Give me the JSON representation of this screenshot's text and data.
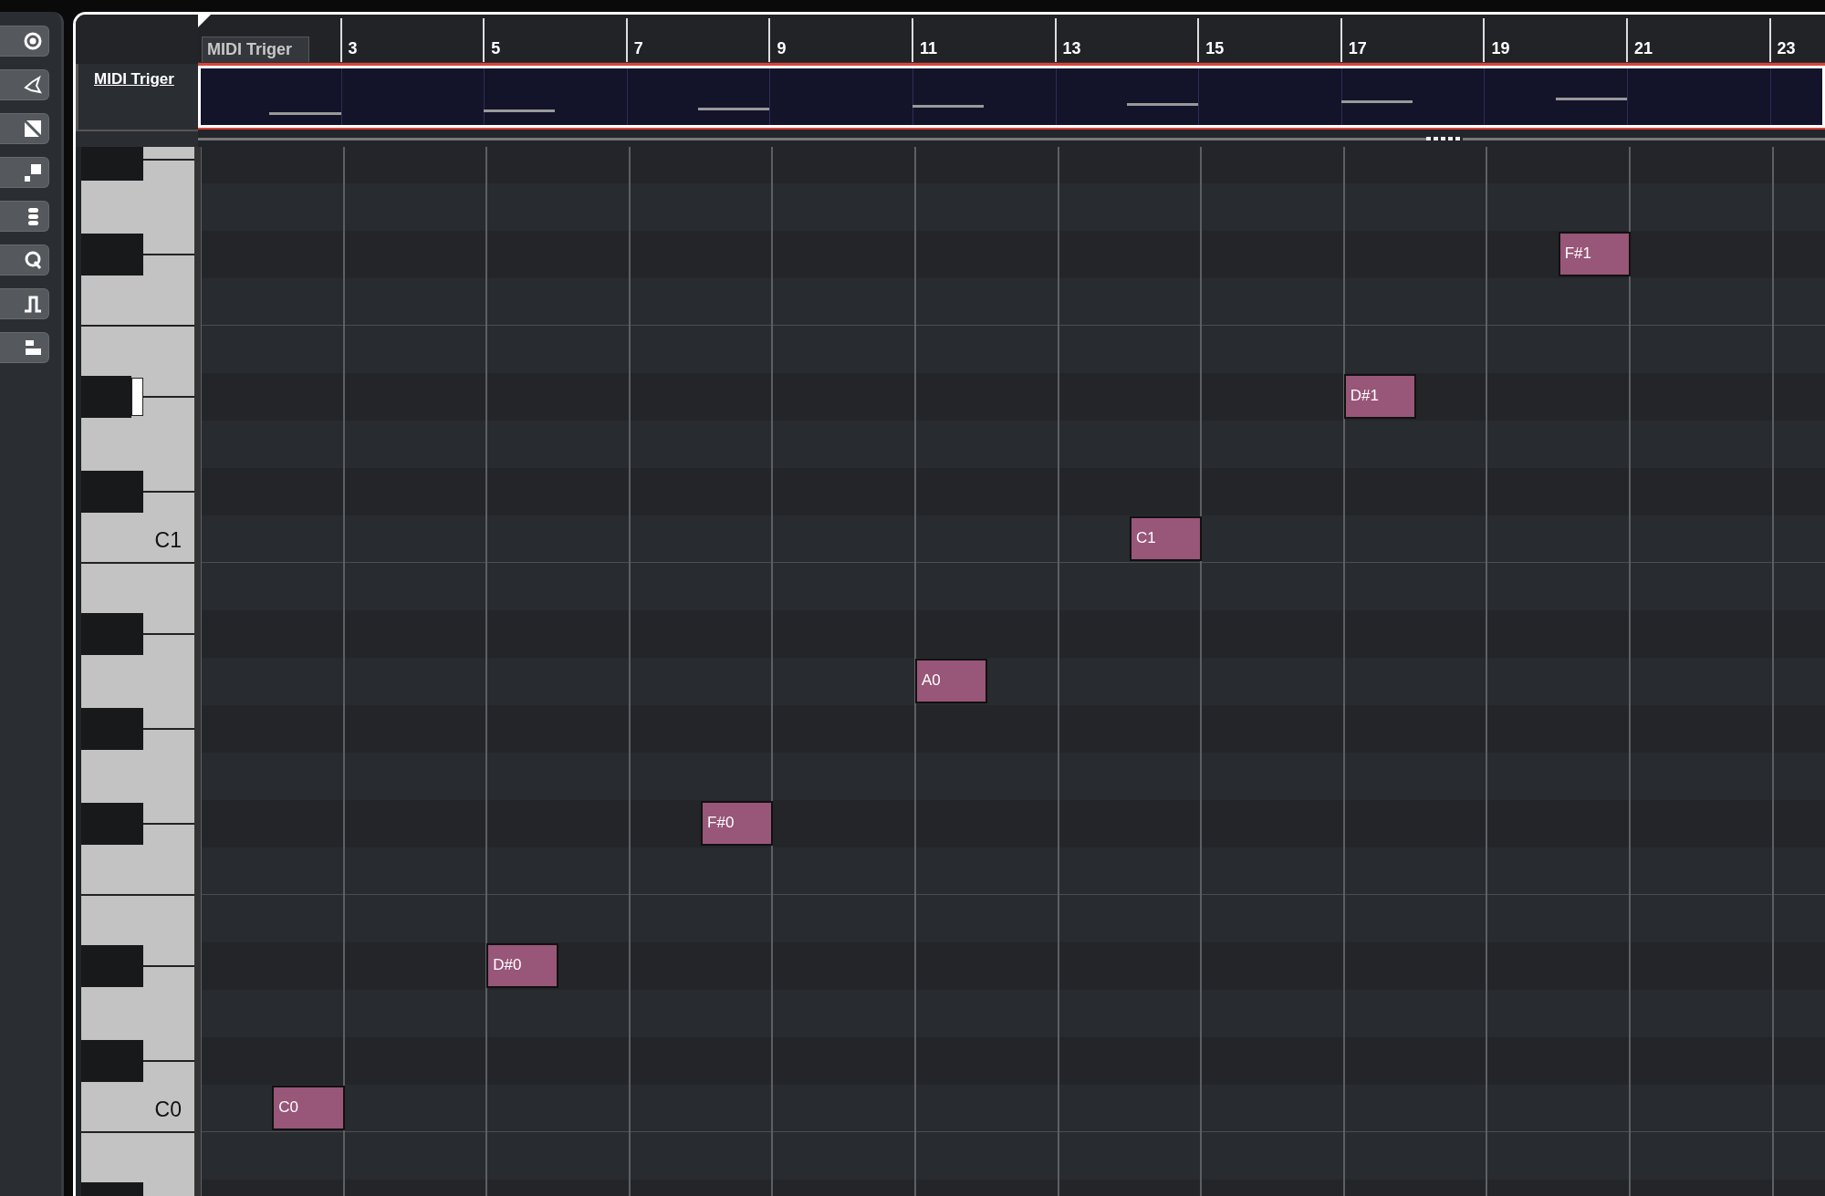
{
  "track": {
    "title": "MIDI Triger"
  },
  "ruler": {
    "part_label": "MIDI Triger",
    "bars": [
      "3",
      "5",
      "7",
      "9",
      "11",
      "13",
      "15",
      "17",
      "19",
      "21",
      "23"
    ]
  },
  "keyboard": {
    "labels": [
      "C1",
      "C0"
    ]
  },
  "notes": [
    {
      "label": "C0"
    },
    {
      "label": "D#0"
    },
    {
      "label": "F#0"
    },
    {
      "label": "A0"
    },
    {
      "label": "C1"
    },
    {
      "label": "D#1"
    },
    {
      "label": "F#1"
    }
  ]
}
